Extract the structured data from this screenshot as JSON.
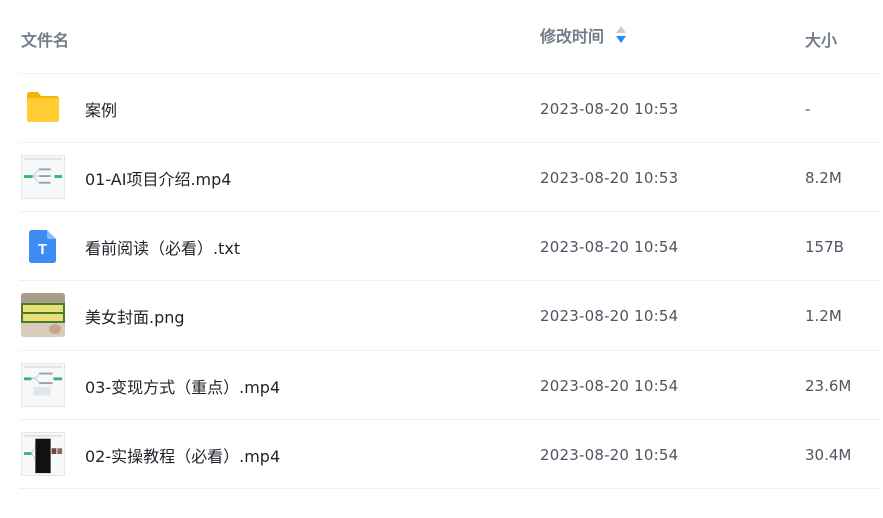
{
  "header": {
    "name_label": "文件名",
    "time_label": "修改时间",
    "size_label": "大小"
  },
  "colors": {
    "folder": "#ffc933",
    "txt_icon": "#3d8cf5",
    "sort_active": "#1f8bff"
  },
  "files": [
    {
      "name": "案例",
      "time": "2023-08-20 10:53",
      "size": "-",
      "icon": "folder-icon"
    },
    {
      "name": "01-AI项目介绍.mp4",
      "time": "2023-08-20 10:53",
      "size": "8.2M",
      "icon": "video-thumbnail"
    },
    {
      "name": "看前阅读（必看）.txt",
      "time": "2023-08-20 10:54",
      "size": "157B",
      "icon": "txt-file-icon",
      "icon_letter": "T"
    },
    {
      "name": "美女封面.png",
      "time": "2023-08-20 10:54",
      "size": "1.2M",
      "icon": "image-thumbnail"
    },
    {
      "name": "03-变现方式（重点）.mp4",
      "time": "2023-08-20 10:54",
      "size": "23.6M",
      "icon": "video-thumbnail"
    },
    {
      "name": "02-实操教程（必看）.mp4",
      "time": "2023-08-20 10:54",
      "size": "30.4M",
      "icon": "video-thumbnail"
    }
  ]
}
